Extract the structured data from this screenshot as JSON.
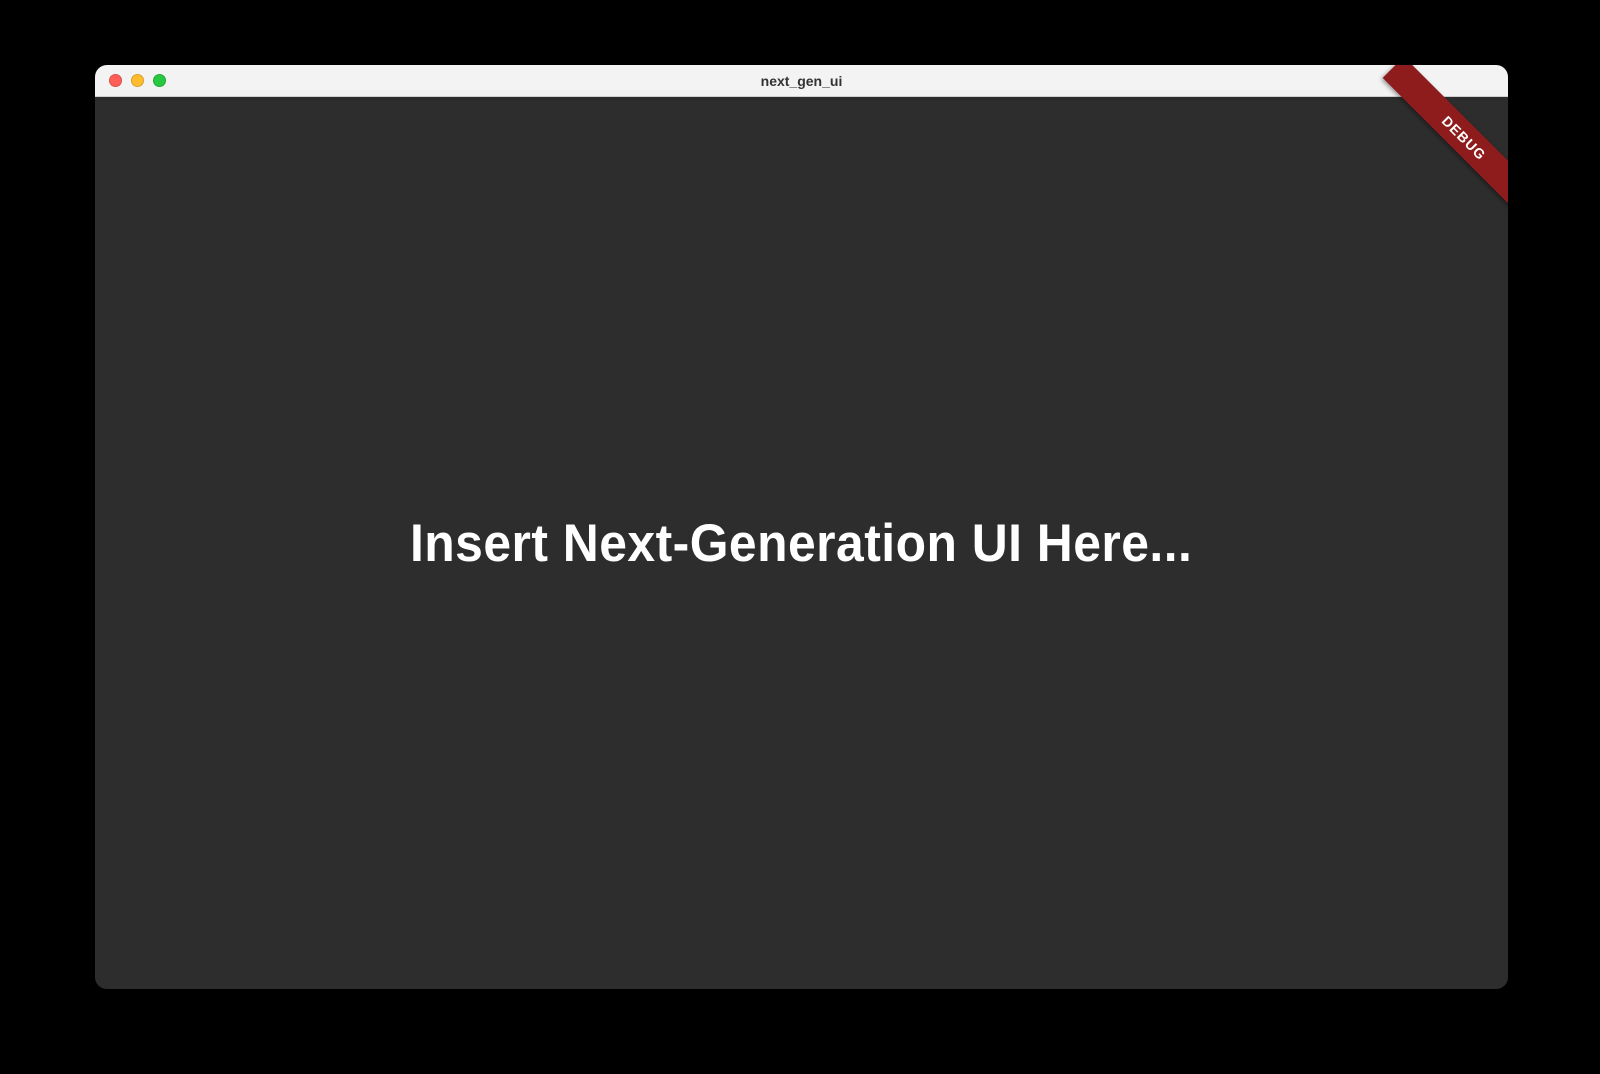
{
  "window": {
    "title": "next_gen_ui"
  },
  "content": {
    "placeholder": "Insert Next-Generation UI Here..."
  },
  "banner": {
    "debug_label": "DEBUG"
  }
}
